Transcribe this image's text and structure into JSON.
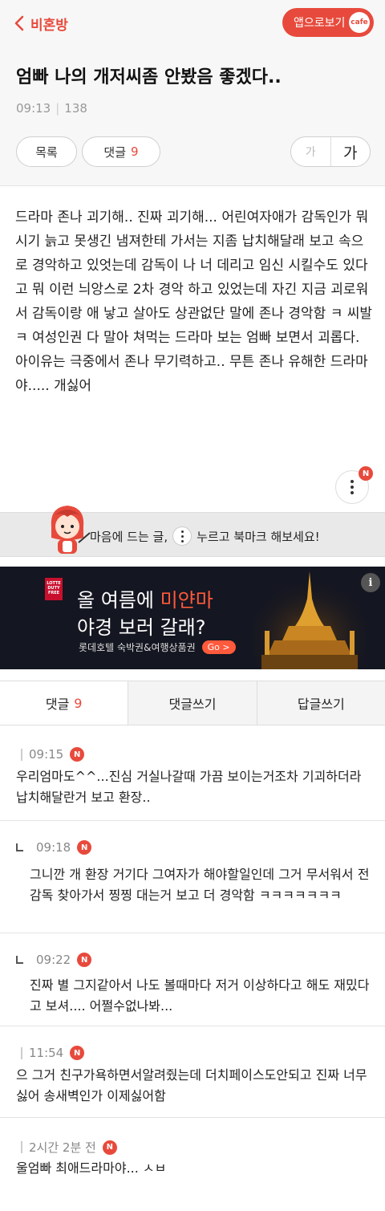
{
  "header": {
    "back_label": "비혼방",
    "app_button_label": "앱으로보기",
    "cafe_logo": "cafe",
    "title": "엄빠 나의 개저씨좀 안봤음 좋겠다..",
    "time": "09:13",
    "views": "138",
    "list_button": "목록",
    "comment_button": "댓글",
    "comment_count": "9",
    "font_small": "가",
    "font_large": "가"
  },
  "post": {
    "body": "드라마 존나 괴기해.. 진짜 괴기해... 어린여자애가 감독인가 뭐시기 늙고 못생긴 냄져한테 가서는 지좀 납치해달래 보고 속으로 경악하고 있엇는데 감독이 나 너 데리고 임신 시킬수도 있다고 뭐 이런 늬앙스로 2차 경악 하고 있었는데 자긴 지금 괴로워서 감독이랑 애 낳고 살아도 상관없단 말에 존나 경악함 ㅋ 씨발 ㅋ 여성인권 다 말아 쳐먹는 드라마 보는 엄빠 보면서 괴롭다. 아이유는 극중에서 존나 무기력하고.. 무튼 존나 유해한 드라마야..... 개싫어",
    "more_badge": "N"
  },
  "bookmark_tip": {
    "text_before": "마음에 드는 글,",
    "text_after": "누르고 북마크 해보세요!"
  },
  "ad": {
    "logo_line1": "LOTTE",
    "logo_line2": "DUTY",
    "logo_line3": "FREE",
    "headline_prefix": "올 여름에 ",
    "headline_highlight": "미얀마",
    "headline_line2": "야경 보러 갈래?",
    "subline": "롯데호텔 숙박권&여행상품권",
    "go_label": "Go >",
    "info_label": "i"
  },
  "tabs": {
    "comments_label": "댓글",
    "comments_count": "9",
    "write_comment": "댓글쓰기",
    "write_reply_post": "답글쓰기"
  },
  "comments": [
    {
      "time": "09:15",
      "badge": "N",
      "text": "우리엄마도^^...진심 거실나갈때 가끔 보이는거조차 기괴하더라 납치해달란거 보고 환장..",
      "reply": false
    },
    {
      "time": "09:18",
      "badge": "N",
      "text": "그니깐 개 환장 거기다 그여자가 해야할일인데 그거 무서워서 전 감독 찾아가서 찡찡 대는거 보고 더 경악함 ㅋㅋㅋㅋㅋㅋㅋ",
      "reply": true
    },
    {
      "time": "09:22",
      "badge": "N",
      "text": "진짜 별 그지같아서 나도 볼때마다 저거 이상하다고 해도 재밌다고 보셔.... 어쩔수없나봐...",
      "reply": true
    },
    {
      "time": "11:54",
      "badge": "N",
      "text": "으 그거 친구가욕하면서알려줬는데 더치페이스도안되고 진짜 너무싫어 송새벽인가 이제싫어함",
      "reply": false
    },
    {
      "time": "2시간 2분 전",
      "badge": "N",
      "text": "울엄빠 최애드라마야... ㅅㅂ",
      "reply": false
    }
  ],
  "colors": {
    "accent": "#e74a3c",
    "ad_background": "#141621"
  }
}
